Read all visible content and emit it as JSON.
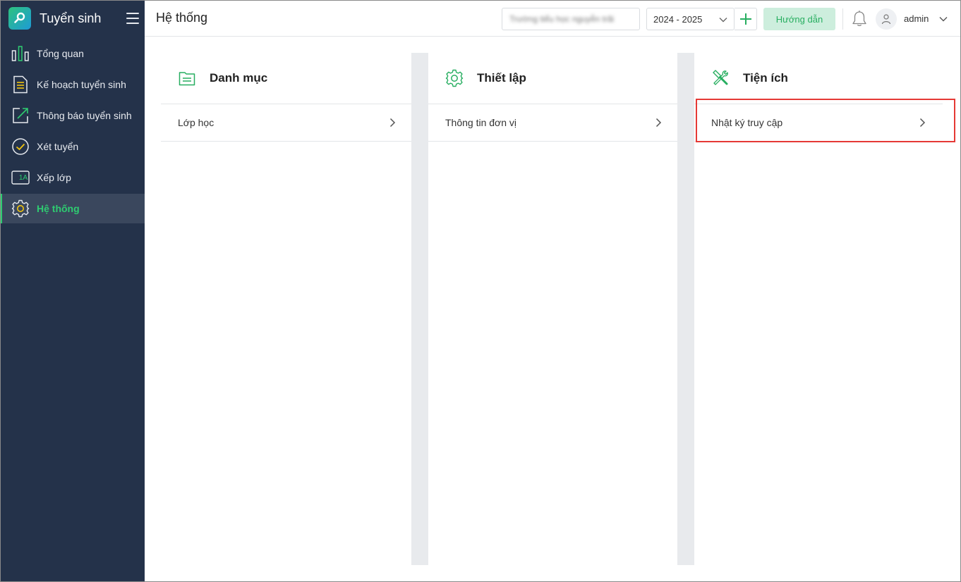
{
  "app": {
    "title": "Tuyển sinh"
  },
  "sidebar": {
    "items": [
      {
        "label": "Tổng quan",
        "icon": "bar-chart-icon",
        "active": false
      },
      {
        "label": "Kế hoạch tuyển sinh",
        "icon": "document-icon",
        "active": false
      },
      {
        "label": "Thông báo tuyển sinh",
        "icon": "external-link-icon",
        "active": false
      },
      {
        "label": "Xét tuyển",
        "icon": "check-circle-icon",
        "active": false
      },
      {
        "label": "Xếp lớp",
        "icon": "class-1a-icon",
        "badge": "1A",
        "active": false
      },
      {
        "label": "Hệ thống",
        "icon": "gear-icon",
        "active": true
      }
    ]
  },
  "header": {
    "title": "Hệ thống",
    "unit_value": "Trường tiểu học nguyễn trãi",
    "year": "2024 - 2025",
    "guide_label": "Hướng dẫn",
    "user": "admin"
  },
  "columns": [
    {
      "title": "Danh mục",
      "icon": "folder-list-icon",
      "rows": [
        {
          "label": "Lớp học"
        }
      ]
    },
    {
      "title": "Thiết lập",
      "icon": "gear-icon",
      "rows": [
        {
          "label": "Thông tin đơn vị"
        }
      ]
    },
    {
      "title": "Tiện ích",
      "icon": "tools-icon",
      "rows": [
        {
          "label": "Nhật ký truy cập"
        }
      ]
    }
  ],
  "colors": {
    "sidebar_bg": "#24324a",
    "accent": "#2ecc71",
    "highlight": "#e53935",
    "icon_gold": "#f1c40f"
  }
}
